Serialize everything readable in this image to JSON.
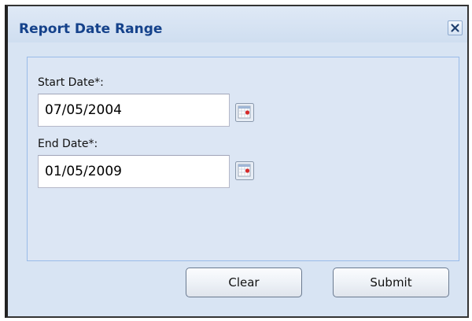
{
  "dialog": {
    "title": "Report Date Range",
    "close_icon": "close-icon",
    "colors": {
      "title": "#15428b",
      "background": "#d8e4f3",
      "panel_border": "#99bbe8"
    }
  },
  "form": {
    "start_date": {
      "label": "Start Date*:",
      "value": "07/05/2004",
      "icon": "calendar-icon"
    },
    "end_date": {
      "label": "End Date*:",
      "value": "01/05/2009",
      "icon": "calendar-icon"
    }
  },
  "buttons": {
    "clear_label": "Clear",
    "submit_label": "Submit"
  }
}
